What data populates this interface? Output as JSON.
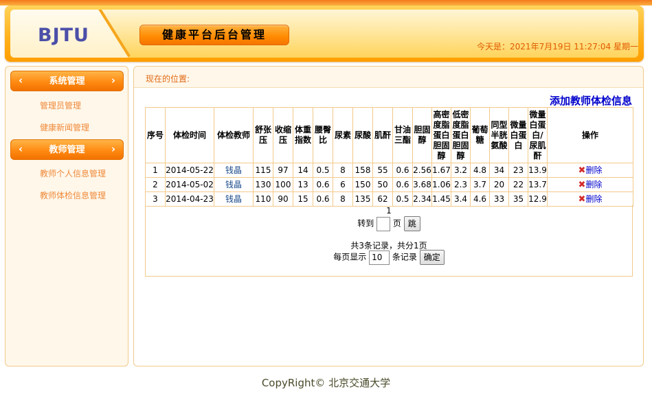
{
  "header": {
    "logo": "BJTU",
    "title": "健康平台后台管理",
    "date_text": "今天是：2021年7月19日 11:27:04 星期一"
  },
  "sidebar": {
    "groups": [
      {
        "label": "系统管理",
        "items": [
          "管理员管理",
          "健康新闻管理"
        ]
      },
      {
        "label": "教师管理",
        "items": [
          "教师个人信息管理",
          "教师体检信息管理"
        ]
      }
    ],
    "chevron_left": "‹",
    "chevron_right": "›"
  },
  "main": {
    "location": "现在的位置:",
    "add_link": "添加教师体检信息",
    "table": {
      "headers": [
        "序号",
        "体检时间",
        "体检教师",
        "舒张压",
        "收缩压",
        "体重指数",
        "腰臀比",
        "尿素",
        "尿酸",
        "肌酐",
        "甘油三酯",
        "胆固醇",
        "高密度脂蛋白胆固醇",
        "低密度脂蛋白胆固醇",
        "葡萄糖",
        "同型半胱氨酸",
        "微量白蛋白",
        "微量白蛋白/尿肌酐",
        "操作"
      ],
      "rows": [
        [
          "1",
          "2014-05-22",
          "钱晶",
          "115",
          "97",
          "14",
          "0.5",
          "8",
          "158",
          "55",
          "0.6",
          "2.56",
          "1.67",
          "3.2",
          "4.8",
          "34",
          "23",
          "13.9"
        ],
        [
          "2",
          "2014-05-02",
          "钱晶",
          "130",
          "100",
          "13",
          "0.6",
          "6",
          "150",
          "50",
          "0.6",
          "3.68",
          "1.06",
          "2.3",
          "3.7",
          "20",
          "22",
          "13.7"
        ],
        [
          "3",
          "2014-04-23",
          "钱晶",
          "110",
          "90",
          "15",
          "0.6",
          "8",
          "135",
          "62",
          "0.5",
          "2.34",
          "1.45",
          "3.4",
          "4.6",
          "33",
          "35",
          "12.9"
        ]
      ],
      "delete_label": "删除",
      "delete_icon": "✖"
    },
    "pager": {
      "current_page": "1",
      "goto_prefix": "转到",
      "goto_value": "",
      "goto_suffix": "页",
      "goto_button": "跳",
      "summary": "共3条记录，共分1页",
      "per_page_prefix": "每页显示",
      "per_page_value": "10",
      "per_page_suffix": "条记录",
      "confirm_button": "确定"
    }
  },
  "footer": {
    "copyright": "CopyRight© 北京交通大学"
  }
}
